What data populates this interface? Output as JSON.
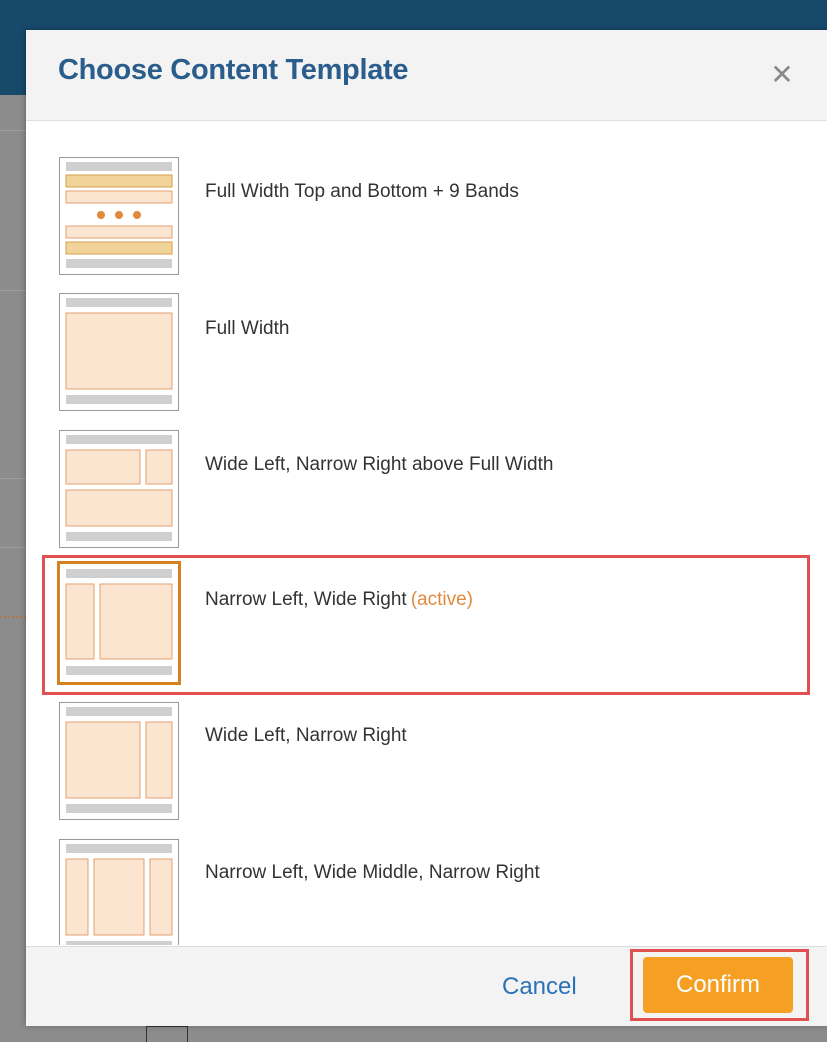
{
  "dialog": {
    "title": "Choose Content Template",
    "close_icon": "close-icon"
  },
  "templates": [
    {
      "label": "Full Width Top and Bottom + 9 Bands",
      "active": false,
      "icon": "bands-layout-icon"
    },
    {
      "label": "Full Width",
      "active": false,
      "icon": "full-width-layout-icon"
    },
    {
      "label": "Wide Left, Narrow Right above Full Width",
      "active": false,
      "icon": "wide-left-narrow-right-above-full-layout-icon"
    },
    {
      "label": "Narrow Left, Wide Right",
      "active": true,
      "active_tag": "(active)",
      "icon": "narrow-left-wide-right-layout-icon"
    },
    {
      "label": "Wide Left, Narrow Right",
      "active": false,
      "icon": "wide-left-narrow-right-layout-icon"
    },
    {
      "label": "Narrow Left, Wide Middle, Narrow Right",
      "active": false,
      "icon": "three-column-layout-icon"
    }
  ],
  "footer": {
    "cancel_label": "Cancel",
    "confirm_label": "Confirm"
  },
  "colors": {
    "title": "#2a5d8c",
    "accent": "#f5a023",
    "active_border": "#d6821e",
    "highlight": "#e05050",
    "link": "#2a72b8"
  }
}
